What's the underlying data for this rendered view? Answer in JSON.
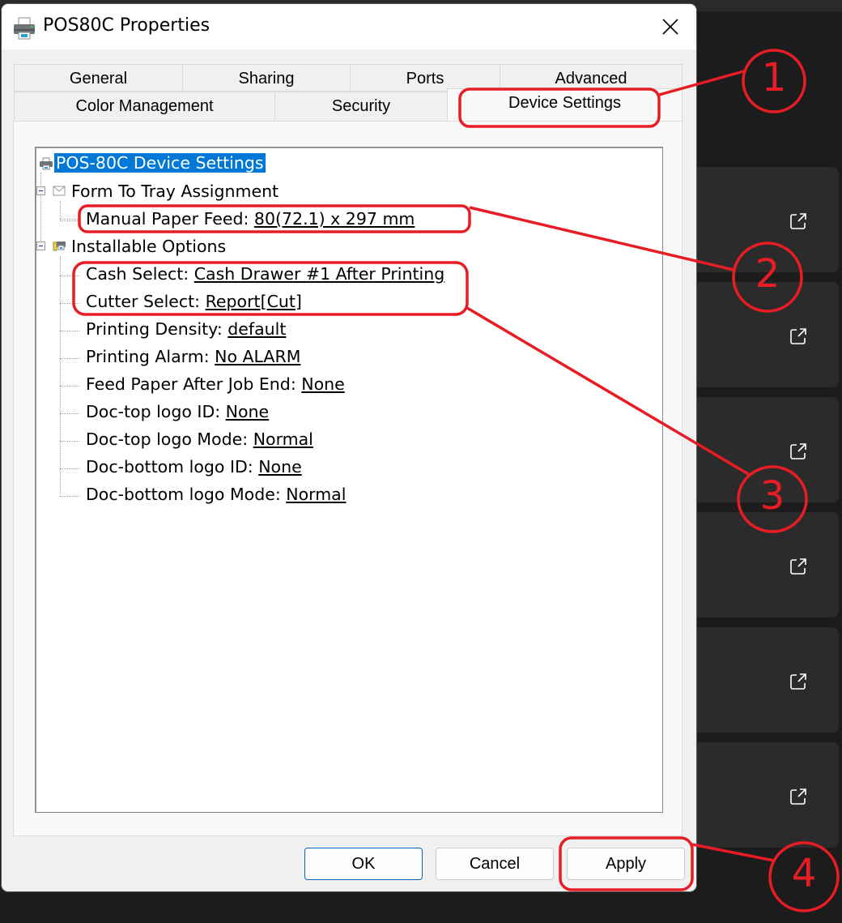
{
  "window": {
    "title": "POS80C Properties",
    "close_label": "Close"
  },
  "tabs": {
    "row1": [
      "General",
      "Sharing",
      "Ports",
      "Advanced"
    ],
    "row2": [
      "Color Management",
      "Security",
      "Device Settings"
    ],
    "active": "Device Settings"
  },
  "tree": {
    "root": "POS-80C Device Settings",
    "form_to_tray": {
      "label": "Form To Tray Assignment",
      "items": [
        {
          "label": "Manual Paper Feed: ",
          "value": "80(72.1) x 297 mm"
        }
      ]
    },
    "installable": {
      "label": "Installable Options",
      "items": [
        {
          "label": "Cash Select: ",
          "value": "Cash Drawer #1 After Printing"
        },
        {
          "label": "Cutter Select: ",
          "value": "Report[Cut]"
        },
        {
          "label": "Printing Density: ",
          "value": "default"
        },
        {
          "label": "Printing Alarm: ",
          "value": "No ALARM"
        },
        {
          "label": "Feed Paper After Job End: ",
          "value": "None"
        },
        {
          "label": "Doc-top logo ID: ",
          "value": "None"
        },
        {
          "label": "Doc-top logo Mode: ",
          "value": "Normal"
        },
        {
          "label": "Doc-bottom logo ID: ",
          "value": "None"
        },
        {
          "label": "Doc-bottom logo Mode: ",
          "value": "Normal"
        }
      ]
    }
  },
  "buttons": {
    "ok": "OK",
    "cancel": "Cancel",
    "apply": "Apply"
  },
  "annotations": {
    "color": "#e81c24",
    "labels": [
      "1",
      "2",
      "3",
      "4"
    ]
  },
  "background_cards": {
    "count": 6,
    "icon": "external-link-icon"
  }
}
